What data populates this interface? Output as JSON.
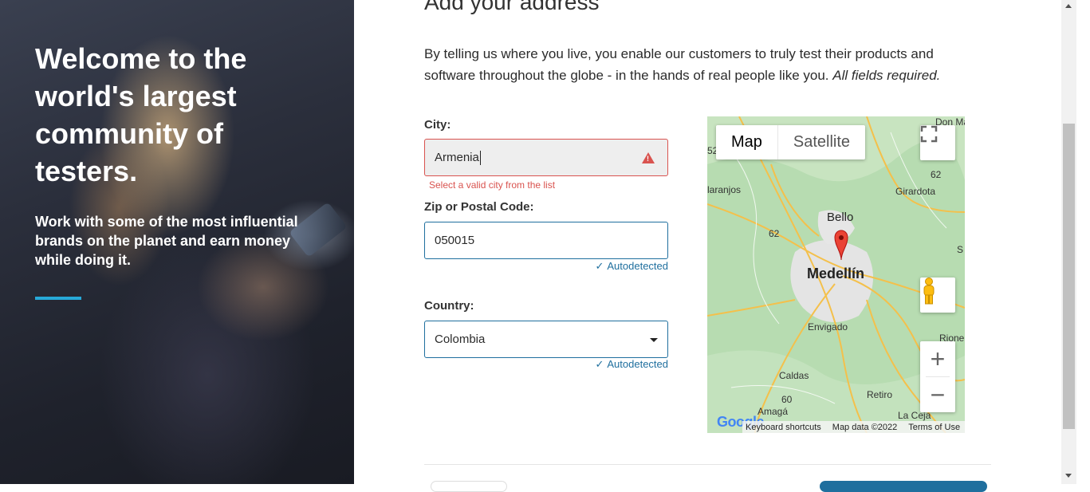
{
  "hero": {
    "title": "Welcome to the world's largest community of testers.",
    "subtitle": "Work with some of the most influential brands on the planet and earn money while doing it."
  },
  "form": {
    "heading": "Add your address",
    "intro": "By telling us where you live, you enable our customers to truly test their products and software throughout the globe - in the hands of real people like you.",
    "intro_required": "All fields required.",
    "city": {
      "label": "City:",
      "value": "Armenia",
      "error": "Select a valid city from the list"
    },
    "zip": {
      "label": "Zip or Postal Code:",
      "value": "050015",
      "status": "Autodetected"
    },
    "country": {
      "label": "Country:",
      "value": "Colombia",
      "status": "Autodetected"
    }
  },
  "map": {
    "tab_map": "Map",
    "tab_satellite": "Satellite",
    "places": {
      "don_mat": "Don Mat",
      "s52": "52",
      "aranjos": "laranjos",
      "girardota": "Girardota",
      "bello": "Bello",
      "medellin": "Medellín",
      "envigado": "Envigado",
      "rione": "Rione",
      "caldas": "Caldas",
      "retiro": "Retiro",
      "amaga": "Amagá",
      "la_ceja": "La Ceja",
      "r62a": "62",
      "r62b": "62",
      "r60": "60",
      "s_edge": "S"
    },
    "footer": {
      "shortcuts": "Keyboard shortcuts",
      "data": "Map data ©2022",
      "terms": "Terms of Use"
    },
    "google": "Google",
    "zoom_in": "+",
    "zoom_out": "−"
  },
  "colors": {
    "accent": "#27a9d8",
    "error": "#d9534f",
    "link": "#1f6f9e"
  }
}
